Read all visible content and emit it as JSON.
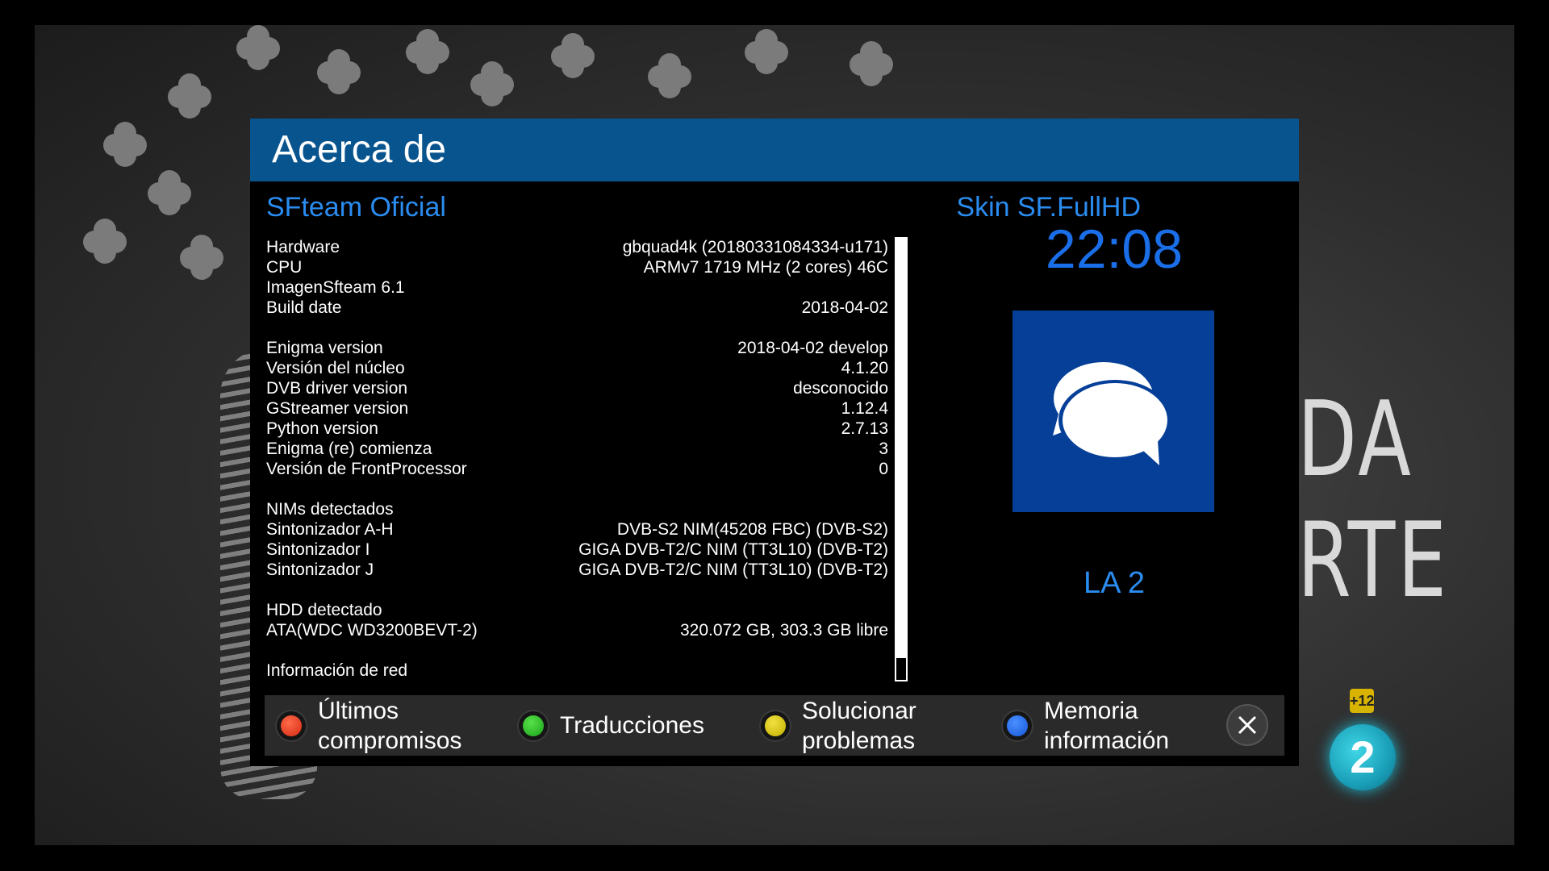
{
  "background": {
    "show_title": "DA\nRTE",
    "age_rating": "+12",
    "channel_logo": "2"
  },
  "dialog": {
    "title": "Acerca de",
    "brand_left": "SFteam Oficial",
    "brand_right": "Skin SF.FullHD",
    "clock": "22:08",
    "tile_icon": "chat-bubbles-icon",
    "channel": "LA 2",
    "info_rows": [
      {
        "key": "Hardware",
        "value": "gbquad4k (20180331084334-u171)"
      },
      {
        "key": "CPU",
        "value": "ARMv7 1719 MHz (2 cores) 46C"
      },
      {
        "key": "ImagenSfteam 6.1",
        "value": ""
      },
      {
        "key": "Build date",
        "value": "2018-04-02"
      },
      {
        "key": "",
        "value": ""
      },
      {
        "key": "Enigma version",
        "value": "2018-04-02 develop"
      },
      {
        "key": "Versión del núcleo",
        "value": "4.1.20"
      },
      {
        "key": "DVB driver version",
        "value": "desconocido"
      },
      {
        "key": "GStreamer version",
        "value": "1.12.4"
      },
      {
        "key": "Python version",
        "value": "2.7.13"
      },
      {
        "key": "Enigma (re) comienza",
        "value": "3"
      },
      {
        "key": "Versión de FrontProcessor",
        "value": "0"
      },
      {
        "key": "",
        "value": ""
      },
      {
        "key": "NIMs detectados",
        "value": ""
      },
      {
        "key": "Sintonizador A-H",
        "value": "DVB-S2 NIM(45208 FBC) (DVB-S2)"
      },
      {
        "key": "Sintonizador I",
        "value": "GIGA DVB-T2/C NIM (TT3L10) (DVB-T2)"
      },
      {
        "key": "Sintonizador J",
        "value": "GIGA DVB-T2/C NIM (TT3L10) (DVB-T2)"
      },
      {
        "key": "",
        "value": ""
      },
      {
        "key": "HDD detectado",
        "value": ""
      },
      {
        "key": "ATA(WDC WD3200BEVT-2)",
        "value": "320.072 GB, 303.3 GB libre"
      },
      {
        "key": "",
        "value": ""
      },
      {
        "key": "Información de red",
        "value": ""
      }
    ],
    "scroll_position": 0.95
  },
  "buttons": {
    "red": "Últimos\ncompromisos",
    "green": "Traducciones",
    "yellow": "Solucionar\nproblemas",
    "blue": "Memoria\ninformación",
    "close_icon": "close-icon"
  },
  "colors": {
    "header": "#08548f",
    "accent": "#2a8cf0",
    "tile": "#063f98"
  }
}
